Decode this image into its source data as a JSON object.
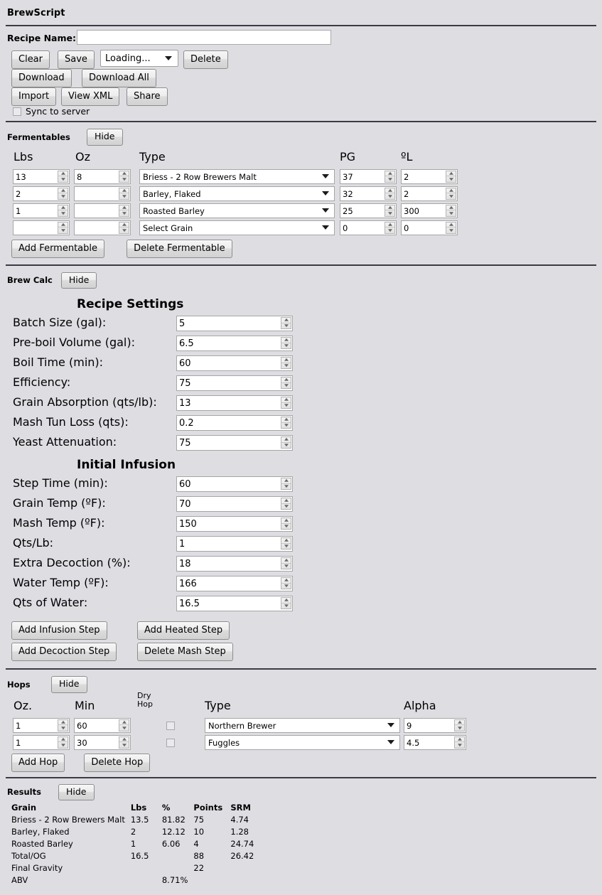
{
  "app": {
    "title": "BrewScript"
  },
  "recipe": {
    "name_label": "Recipe Name:",
    "name_value": "",
    "buttons": {
      "clear": "Clear",
      "save": "Save",
      "delete": "Delete",
      "download": "Download",
      "download_all": "Download All",
      "import": "Import",
      "view_xml": "View XML",
      "share": "Share"
    },
    "recipe_select_value": "Loading...",
    "sync_label": "Sync to server",
    "sync_checked": false
  },
  "fermentables": {
    "section_label": "Fermentables",
    "hide_label": "Hide",
    "headers": {
      "lbs": "Lbs",
      "oz": "Oz",
      "type": "Type",
      "pg": "PG",
      "lovibond": "ºL"
    },
    "rows": [
      {
        "lbs": "13",
        "oz": "8",
        "type": "Briess - 2 Row Brewers Malt",
        "pg": "37",
        "lovibond": "2"
      },
      {
        "lbs": "2",
        "oz": "",
        "type": "Barley, Flaked",
        "pg": "32",
        "lovibond": "2"
      },
      {
        "lbs": "1",
        "oz": "",
        "type": "Roasted Barley",
        "pg": "25",
        "lovibond": "300"
      },
      {
        "lbs": "",
        "oz": "",
        "type": "Select Grain",
        "pg": "0",
        "lovibond": "0"
      }
    ],
    "add_label": "Add Fermentable",
    "delete_label": "Delete Fermentable"
  },
  "brewcalc": {
    "section_label": "Brew Calc",
    "hide_label": "Hide",
    "recipe_settings_title": "Recipe Settings",
    "recipe_settings": [
      {
        "label": "Batch Size (gal):",
        "value": "5"
      },
      {
        "label": "Pre-boil Volume (gal):",
        "value": "6.5"
      },
      {
        "label": "Boil Time (min):",
        "value": "60"
      },
      {
        "label": "Efficiency:",
        "value": "75"
      },
      {
        "label": "Grain Absorption (qts/lb):",
        "value": "13"
      },
      {
        "label": "Mash Tun Loss (qts):",
        "value": "0.2"
      },
      {
        "label": "Yeast Attenuation:",
        "value": "75"
      }
    ],
    "initial_infusion_title": "Initial Infusion",
    "initial_infusion": [
      {
        "label": "Step Time (min):",
        "value": "60"
      },
      {
        "label": "Grain Temp (ºF):",
        "value": "70"
      },
      {
        "label": "Mash Temp (ºF):",
        "value": "150"
      },
      {
        "label": "Qts/Lb:",
        "value": "1"
      },
      {
        "label": "Extra Decoction (%):",
        "value": "18"
      },
      {
        "label": "Water Temp (ºF):",
        "value": "166"
      },
      {
        "label": "Qts of Water:",
        "value": "16.5"
      }
    ],
    "mash_buttons": {
      "add_infusion": "Add Infusion Step",
      "add_heated": "Add Heated Step",
      "add_decoction": "Add Decoction Step",
      "delete_step": "Delete Mash Step"
    }
  },
  "hops": {
    "section_label": "Hops",
    "hide_label": "Hide",
    "headers": {
      "oz": "Oz.",
      "min": "Min",
      "dry1": "Dry",
      "dry2": "Hop",
      "type": "Type",
      "alpha": "Alpha"
    },
    "rows": [
      {
        "oz": "1",
        "min": "60",
        "dry_hop": false,
        "type": "Northern Brewer",
        "alpha": "9"
      },
      {
        "oz": "1",
        "min": "30",
        "dry_hop": false,
        "type": "Fuggles",
        "alpha": "4.5"
      }
    ],
    "add_label": "Add Hop",
    "delete_label": "Delete Hop"
  },
  "results": {
    "section_label": "Results",
    "hide_label": "Hide",
    "headers": [
      "Grain",
      "Lbs",
      "%",
      "Points",
      "SRM"
    ],
    "rows": [
      {
        "grain": "Briess - 2 Row Brewers Malt",
        "lbs": "13.5",
        "pct": "81.82",
        "points": "75",
        "srm": "4.74"
      },
      {
        "grain": "Barley, Flaked",
        "lbs": "2",
        "pct": "12.12",
        "points": "10",
        "srm": "1.28"
      },
      {
        "grain": "Roasted Barley",
        "lbs": "1",
        "pct": "6.06",
        "points": "4",
        "srm": "24.74"
      },
      {
        "grain": "Total/OG",
        "lbs": "16.5",
        "pct": "",
        "points": "88",
        "srm": "26.42"
      },
      {
        "grain": "Final Gravity",
        "lbs": "",
        "pct": "",
        "points": "22",
        "srm": ""
      },
      {
        "grain": "ABV",
        "lbs": "",
        "pct": "8.71%",
        "points": "",
        "srm": ""
      }
    ]
  },
  "colors": {
    "background": "#dedde2",
    "divider": "#3b3b45"
  }
}
